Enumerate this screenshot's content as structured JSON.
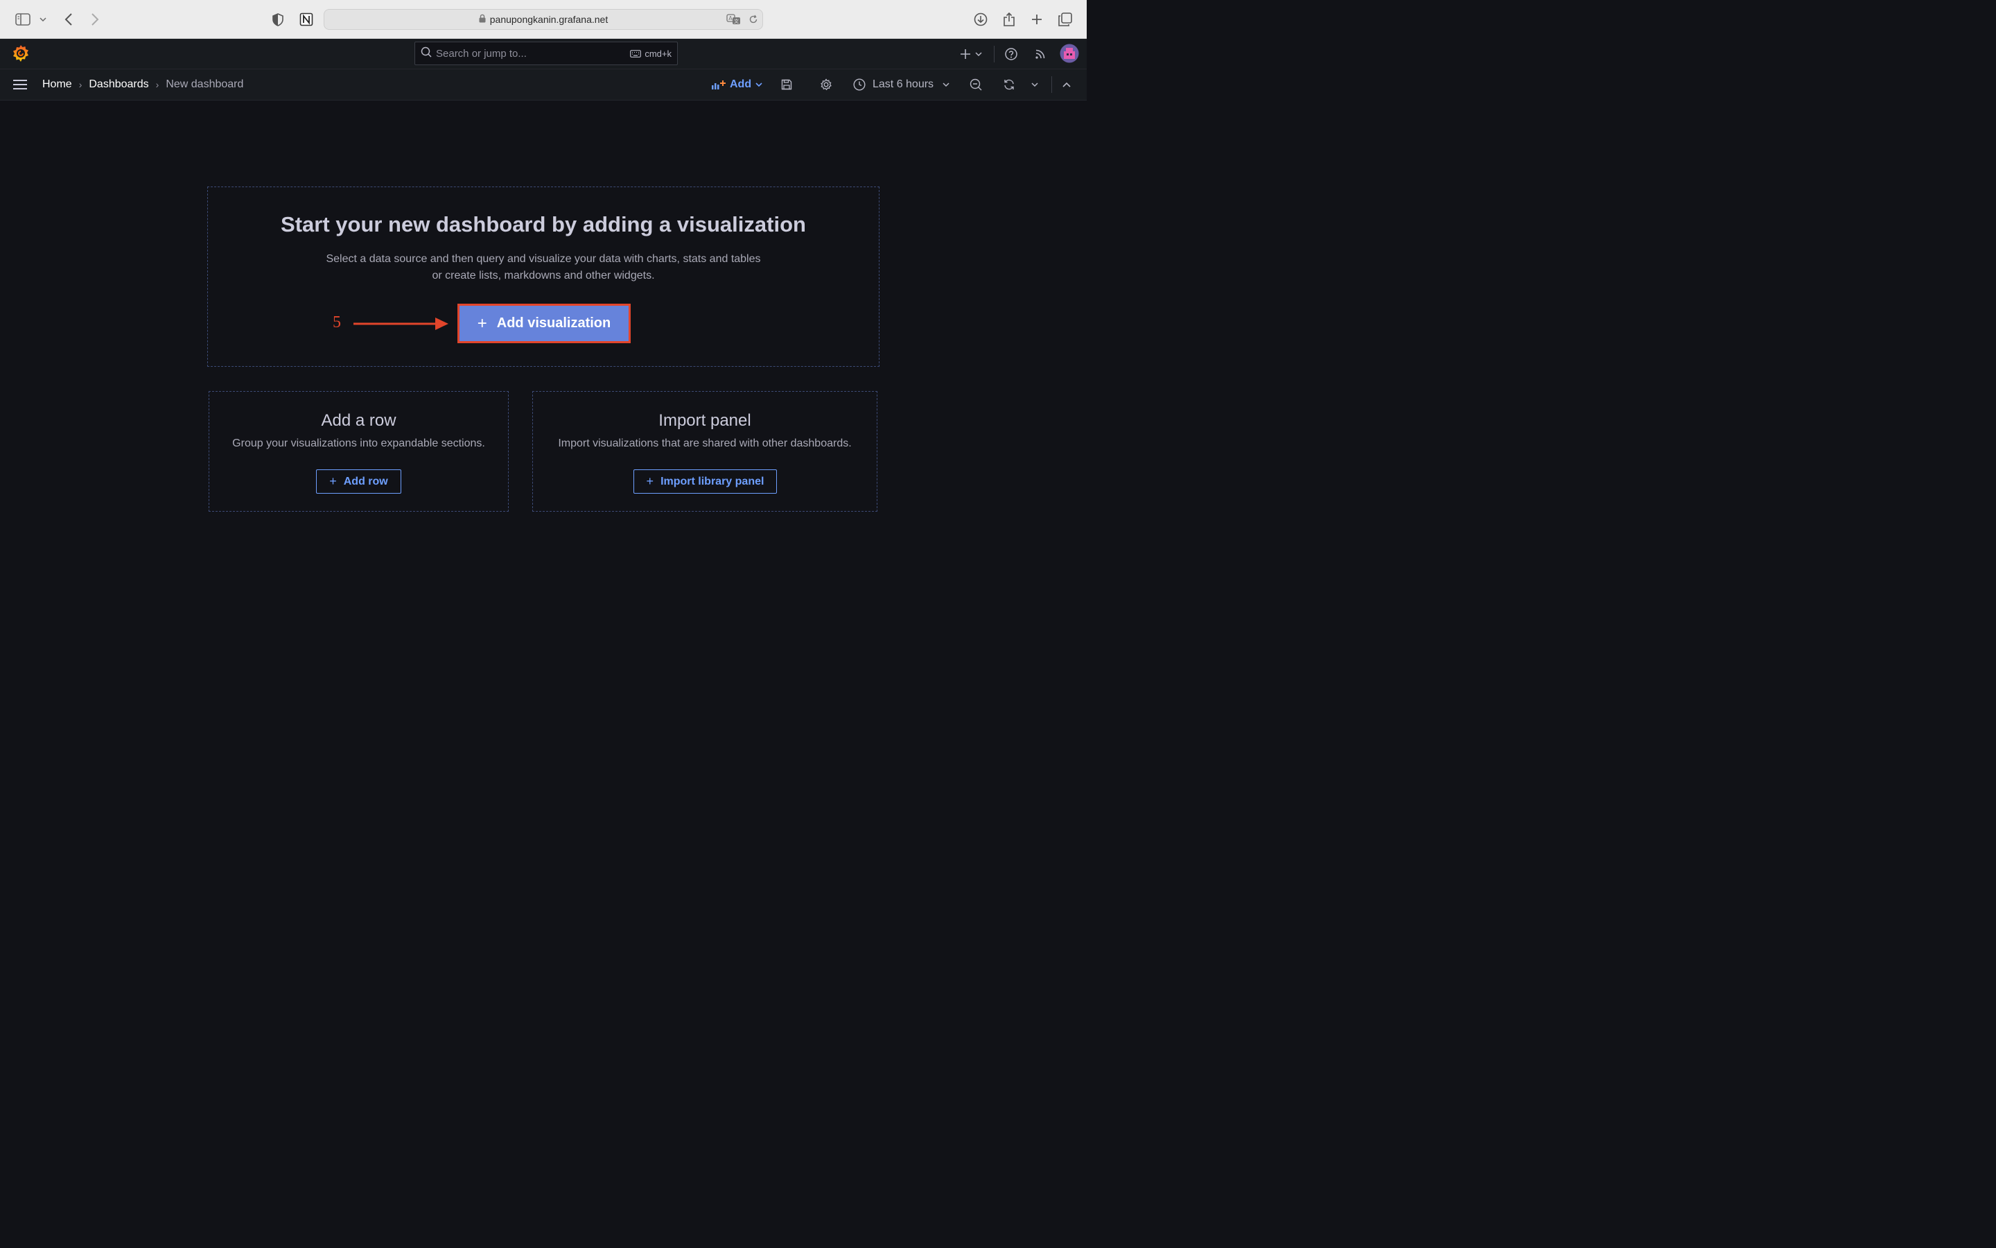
{
  "browser": {
    "url": "panupongkanin.grafana.net"
  },
  "topnav": {
    "search_placeholder": "Search or jump to...",
    "shortcut": "cmd+k"
  },
  "breadcrumb": {
    "items": [
      "Home",
      "Dashboards",
      "New dashboard"
    ]
  },
  "toolbar": {
    "add_label": "Add",
    "time_range": "Last 6 hours"
  },
  "empty_state": {
    "title": "Start your new dashboard by adding a visualization",
    "description_line1": "Select a data source and then query and visualize your data with charts, stats and tables",
    "description_line2": "or create lists, markdowns and other widgets.",
    "add_visualization_label": "Add visualization"
  },
  "annotation": {
    "step_number": "5",
    "color": "#e2452b"
  },
  "add_row_card": {
    "title": "Add a row",
    "description": "Group your visualizations into expandable sections.",
    "button_label": "Add row"
  },
  "import_card": {
    "title": "Import panel",
    "description": "Import visualizations that are shared with other dashboards.",
    "button_label": "Import library panel"
  },
  "colors": {
    "background": "#111217",
    "primary_button": "#6683db",
    "link_blue": "#6e9fff",
    "grafana_orange": "#f46800"
  },
  "icons": [
    "sidebar-icon",
    "back-icon",
    "forward-icon",
    "shield-icon",
    "notion-icon",
    "lock-icon",
    "translate-icon",
    "reload-icon",
    "download-icon",
    "share-icon",
    "new-tab-icon",
    "tabs-icon",
    "grafana-logo-icon",
    "search-icon",
    "keyboard-icon",
    "plus-icon",
    "help-icon",
    "rss-icon",
    "avatar",
    "hamburger-icon",
    "add-panel-icon",
    "save-icon",
    "gear-icon",
    "clock-icon",
    "zoom-out-icon",
    "refresh-icon",
    "chevron-up-icon"
  ]
}
